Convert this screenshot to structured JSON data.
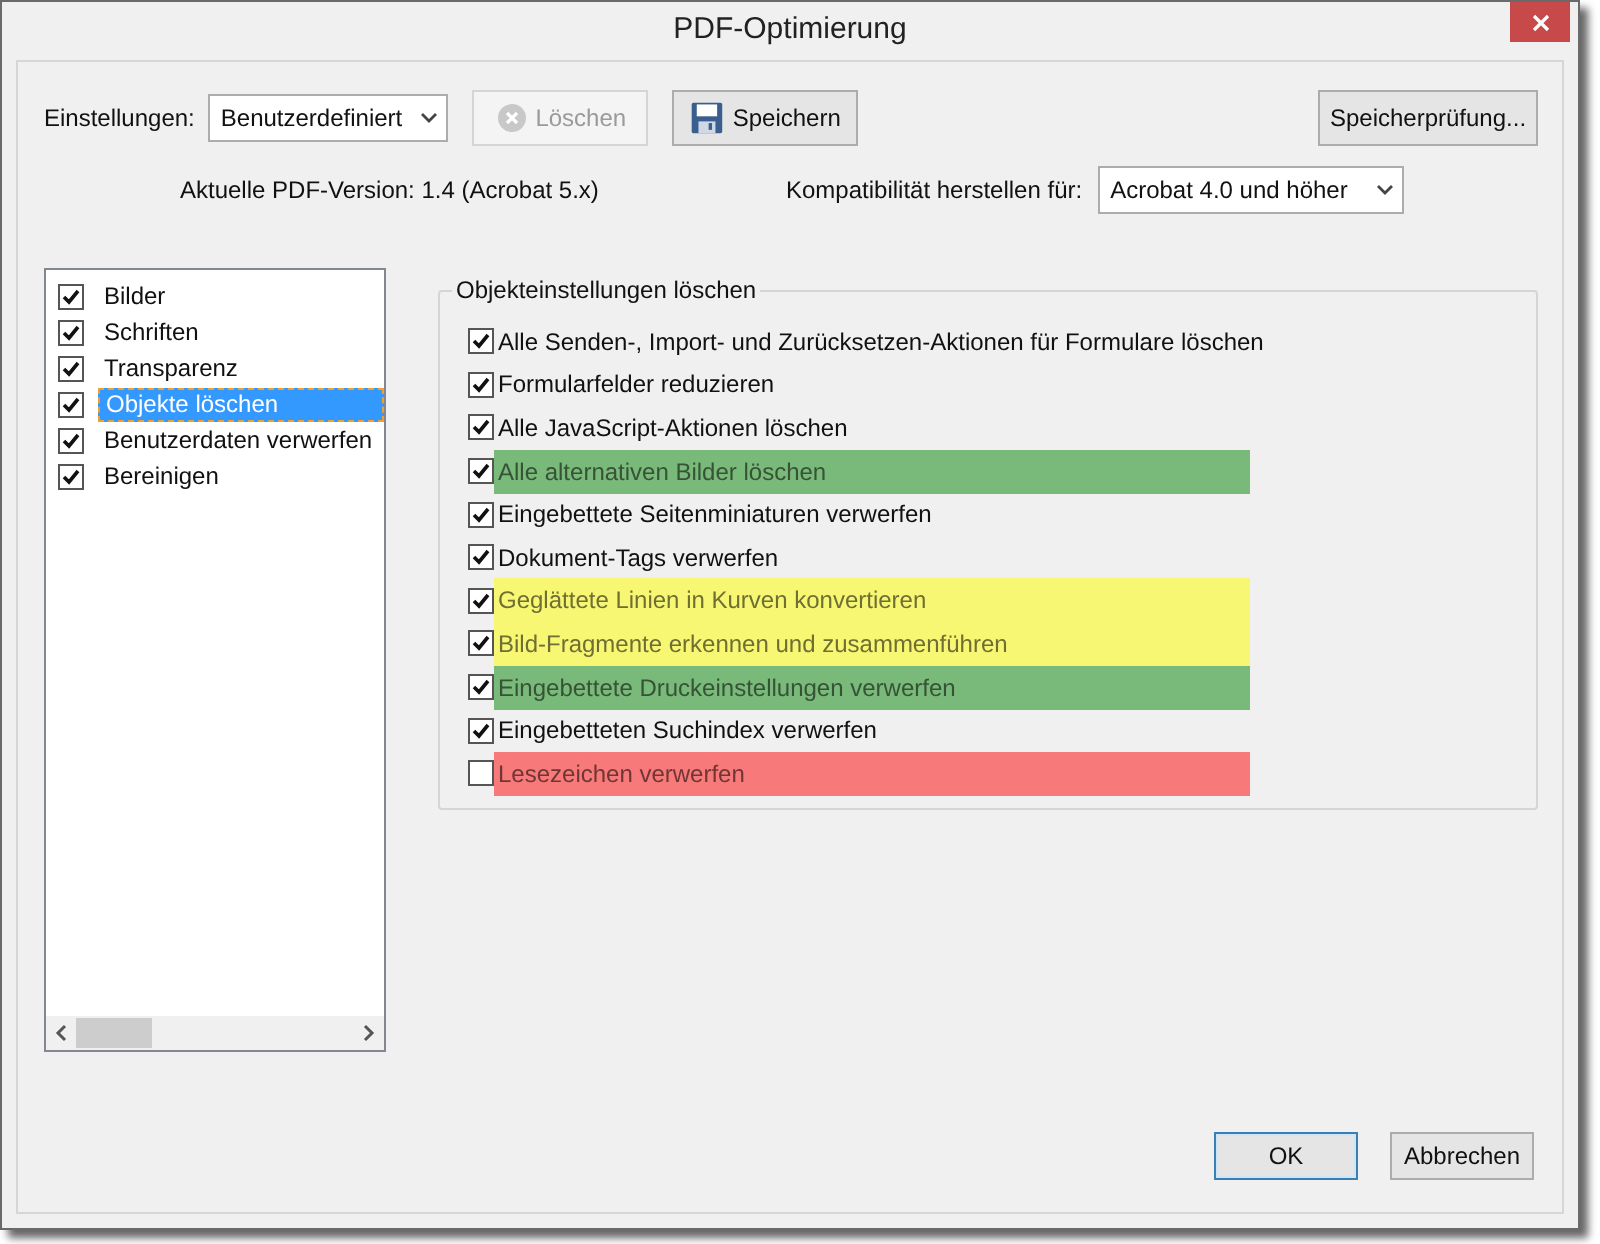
{
  "window": {
    "title": "PDF-Optimierung"
  },
  "settings": {
    "label": "Einstellungen:",
    "value": "Benutzerdefiniert"
  },
  "buttons": [
    {
      "label": "Löschen",
      "disabled": true,
      "kind": "delete"
    },
    {
      "label": "Speichern",
      "disabled": false,
      "kind": "save"
    },
    {
      "label": "Speicherprüfung...",
      "disabled": false,
      "kind": "plain"
    }
  ],
  "version": "Aktuelle PDF-Version: 1.4 (Acrobat 5.x)",
  "compat": {
    "label": "Kompatibilität herstellen für:",
    "value": "Acrobat 4.0 und höher"
  },
  "sidebar": {
    "items": [
      {
        "label": "Bilder",
        "checked": true,
        "selected": false
      },
      {
        "label": "Schriften",
        "checked": true,
        "selected": false
      },
      {
        "label": "Transparenz",
        "checked": true,
        "selected": false
      },
      {
        "label": "Objekte löschen",
        "checked": true,
        "selected": true
      },
      {
        "label": "Benutzerdaten verwerfen",
        "checked": true,
        "selected": false
      },
      {
        "label": "Bereinigen",
        "checked": true,
        "selected": false
      }
    ]
  },
  "group": {
    "title": "Objekteinstellungen löschen",
    "options": [
      {
        "label": "Alle Senden-, Import- und Zurücksetzen-Aktionen für Formulare löschen",
        "checked": true
      },
      {
        "label": "Formularfelder reduzieren",
        "checked": true
      },
      {
        "label": "Alle JavaScript-Aktionen löschen",
        "checked": true
      },
      {
        "label": "Alle alternativen Bilder löschen",
        "checked": true,
        "color": "#79b979"
      },
      {
        "label": "Eingebettete Seitenminiaturen verwerfen",
        "checked": true
      },
      {
        "label": "Dokument-Tags verwerfen",
        "checked": true
      },
      {
        "label": "Geglättete Linien in Kurven konvertieren",
        "checked": true,
        "color": "#f7f774"
      },
      {
        "label": "Bild-Fragmente erkennen und zusammenführen",
        "checked": true,
        "color": "#f7f774"
      },
      {
        "label": "Eingebettete Druckeinstellungen verwerfen",
        "checked": true,
        "color": "#79b979"
      },
      {
        "label": "Eingebetteten Suchindex verwerfen",
        "checked": true
      },
      {
        "label": "Lesezeichen verwerfen",
        "checked": false,
        "color": "#f87979"
      }
    ]
  },
  "footer": [
    {
      "label": "OK",
      "default": true
    },
    {
      "label": "Abbrechen",
      "default": false
    }
  ]
}
